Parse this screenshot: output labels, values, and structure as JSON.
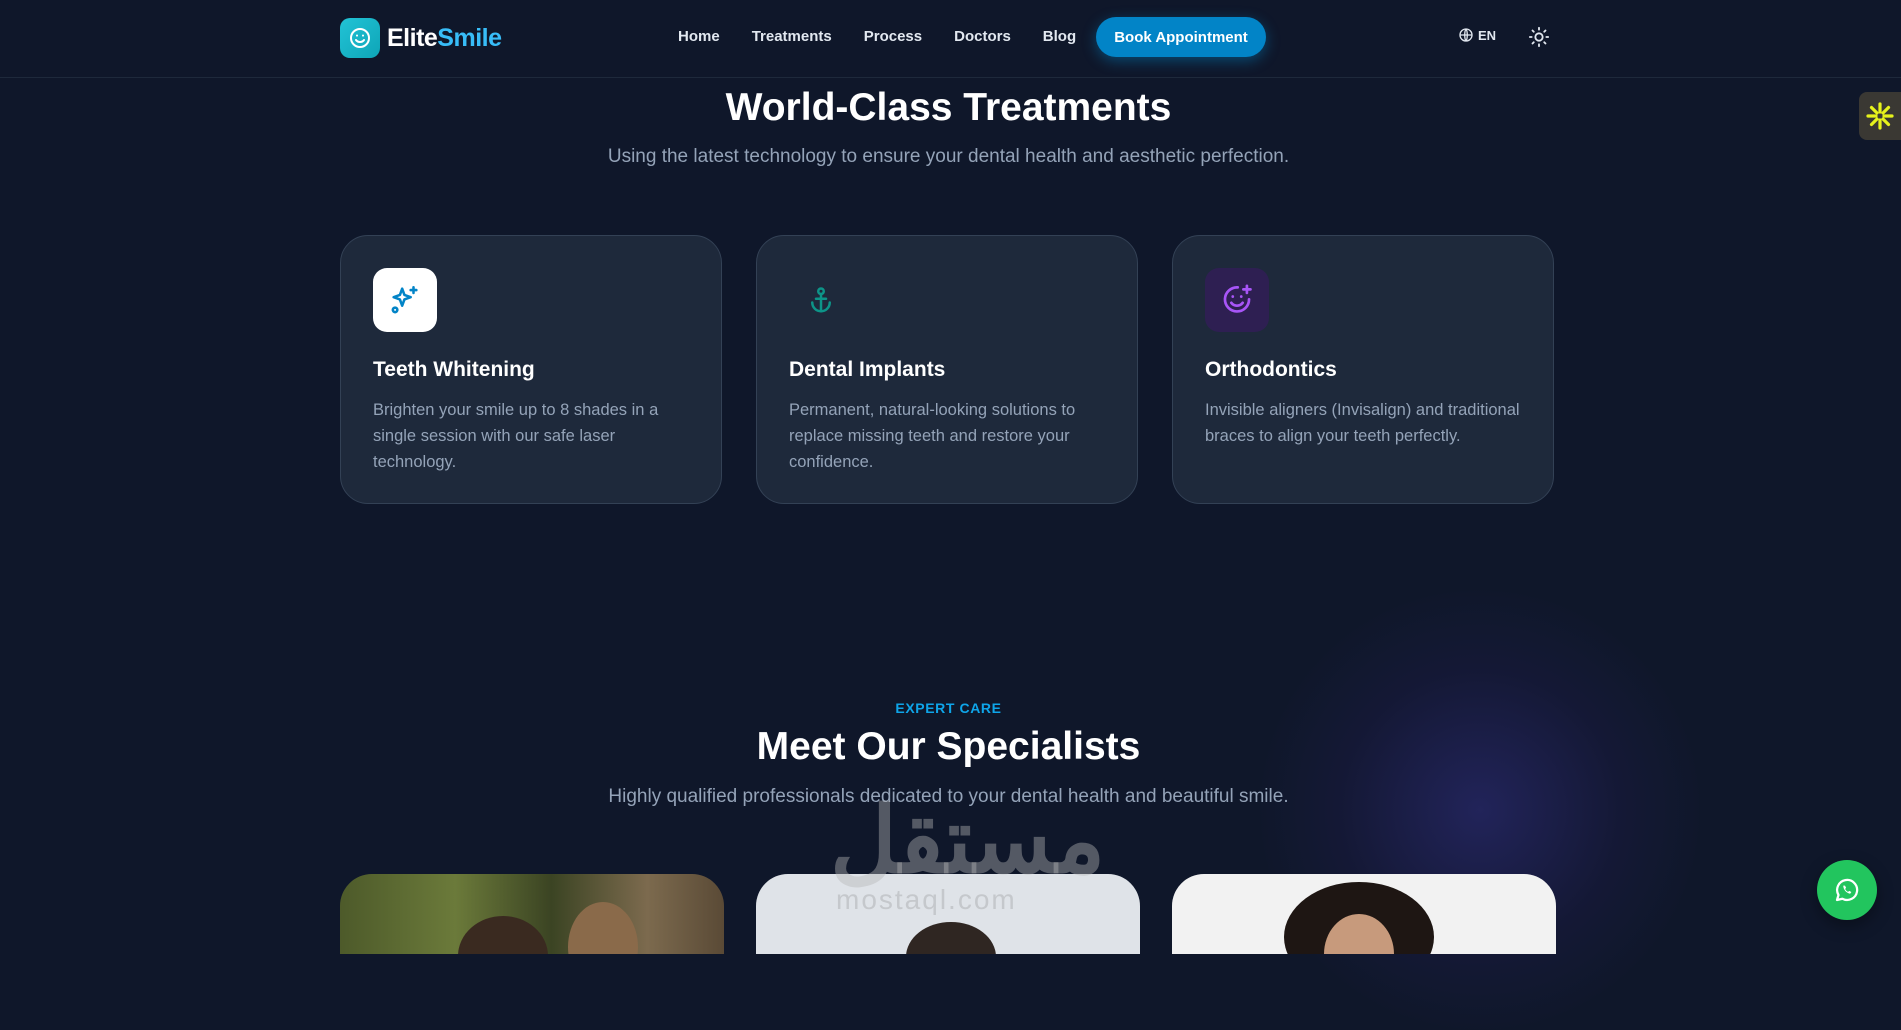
{
  "header": {
    "logo_part1": "Elite",
    "logo_part2": "Smile",
    "logo_icon": "smile-icon",
    "nav": [
      {
        "label": "Home"
      },
      {
        "label": "Treatments"
      },
      {
        "label": "Process"
      },
      {
        "label": "Doctors"
      },
      {
        "label": "Blog"
      }
    ],
    "cta_label": "Book Appointment",
    "language": "EN",
    "language_icon": "globe-icon",
    "theme_icon": "sun-icon"
  },
  "treatments": {
    "title": "World-Class Treatments",
    "subtitle": "Using the latest technology to ensure your dental health and aesthetic perfection.",
    "cards": [
      {
        "title": "Teeth Whitening",
        "description": "Brighten your smile up to 8 shades in a single session with our safe laser technology.",
        "icon": "sparkles-icon",
        "icon_color": "#0284c7"
      },
      {
        "title": "Dental Implants",
        "description": "Permanent, natural-looking solutions to replace missing teeth and restore your confidence.",
        "icon": "anchor-icon",
        "icon_color": "#0d9488"
      },
      {
        "title": "Orthodontics",
        "description": "Invisible aligners (Invisalign) and traditional braces to align your teeth perfectly.",
        "icon": "smile-plus-icon",
        "icon_color": "#a855f7"
      }
    ]
  },
  "specialists": {
    "eyebrow": "EXPERT CARE",
    "title": "Meet Our Specialists",
    "subtitle": "Highly qualified professionals dedicated to your dental health and beautiful smile."
  },
  "watermark": {
    "text": "مستقل",
    "subtext": "mostaql.com"
  },
  "widgets": {
    "whatsapp_icon": "whatsapp-icon",
    "side_widget_icon": "asterisk-icon"
  },
  "colors": {
    "background": "#0f172a",
    "card": "#1e293b",
    "accent": "#0284c7",
    "whatsapp": "#22c55e"
  }
}
